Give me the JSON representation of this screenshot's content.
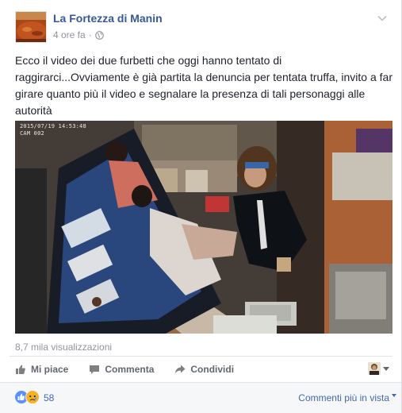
{
  "post": {
    "page_name": "La Fortezza di Manin",
    "timestamp": "4 ore fa",
    "separator": "·",
    "privacy_icon": "globe-icon",
    "text": "Ecco il video dei due furbetti che oggi hanno tentato di raggirarci...Ovviamente è già partita la denuncia per tentata truffa, invito a far girare quanto più il video e segnalare la presenza di tali personaggi alle autorità"
  },
  "video": {
    "camera_timestamp": "2015/07/19 14:53:48",
    "camera_label": "CAM 002"
  },
  "stats": {
    "views": "8,7 mila visualizzazioni"
  },
  "actions": {
    "like_label": "Mi piace",
    "comment_label": "Commenta",
    "share_label": "Condividi"
  },
  "reactions": {
    "icons": [
      "like-icon",
      "sad-icon"
    ],
    "count": "58",
    "sort_label": "Commenti più in vista"
  },
  "colors": {
    "link_blue": "#365899",
    "accent_blue": "#4267b2",
    "meta_gray": "#90949c",
    "action_gray": "#616770"
  }
}
